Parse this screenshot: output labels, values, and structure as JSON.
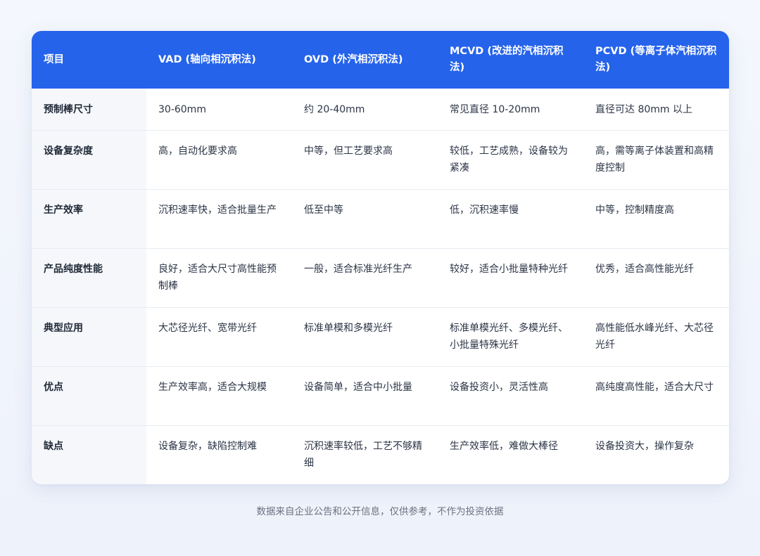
{
  "table": {
    "headers": [
      "项目",
      "VAD (轴向相沉积法)",
      "OVD (外汽相沉积法)",
      "MCVD (改进的汽相沉积法)",
      "PCVD (等离子体汽相沉积法)"
    ],
    "rows": [
      [
        "预制棒尺寸",
        "30-60mm",
        "约 20-40mm",
        "常见直径 10-20mm",
        "直径可达 80mm 以上"
      ],
      [
        "设备复杂度",
        "高，自动化要求高",
        "中等，但工艺要求高",
        "较低，工艺成熟，设备较为紧凑",
        "高，需等离子体装置和高精度控制"
      ],
      [
        "生产效率",
        "沉积速率快，适合批量生产",
        "低至中等",
        "低，沉积速率慢",
        "中等，控制精度高"
      ],
      [
        "产品纯度性能",
        "良好，适合大尺寸高性能预制棒",
        "一般，适合标准光纤生产",
        "较好，适合小批量特种光纤",
        "优秀，适合高性能光纤"
      ],
      [
        "典型应用",
        "大芯径光纤、宽带光纤",
        "标准单模和多模光纤",
        "标准单模光纤、多模光纤、小批量特殊光纤",
        "高性能低水峰光纤、大芯径光纤"
      ],
      [
        "优点",
        "生产效率高，适合大规模",
        "设备简单，适合中小批量",
        "设备投资小，灵活性高",
        "高纯度高性能，适合大尺寸"
      ],
      [
        "缺点",
        "设备复杂，缺陷控制难",
        "沉积速率较低，工艺不够精细",
        "生产效率低，难做大棒径",
        "设备投资大，操作复杂"
      ]
    ]
  },
  "footer": "数据来自企业公告和公开信息，仅供参考，不作为投资依据",
  "colors": {
    "header_bg": "#2563eb",
    "row_head_bg": "#f5f7fb",
    "page_bg": "#eef2fb"
  }
}
